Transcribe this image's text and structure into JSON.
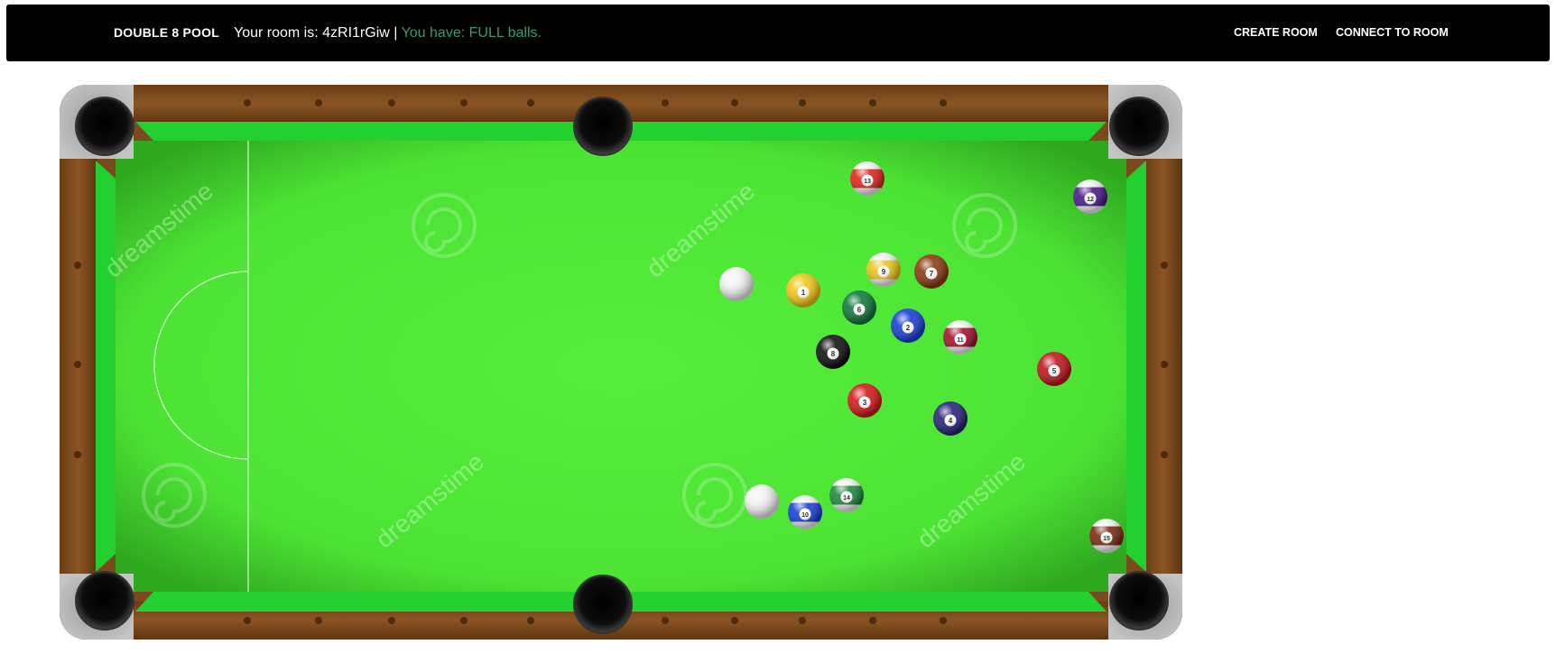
{
  "header": {
    "brand": "DOUBLE 8 POOL",
    "room_prefix": "Your room is: ",
    "room_code": "4zRI1rGiw",
    "separator": " | ",
    "balls_status": "You have: FULL balls."
  },
  "nav": {
    "create_room": "CREATE ROOM",
    "connect_room": "CONNECT TO ROOM"
  },
  "table": {
    "felt_color": "#4fe637",
    "rail_color": "#7a4a1e",
    "watermark": "dreamstime"
  },
  "balls": [
    {
      "label": "",
      "kind": "cue",
      "color": "#f2f2f2"
    },
    {
      "label": "",
      "kind": "cue",
      "color": "#f2f2f2"
    },
    {
      "label": "1",
      "kind": "solid",
      "color": "#f2c81a"
    },
    {
      "label": "2",
      "kind": "solid",
      "color": "#1a3fd6"
    },
    {
      "label": "3",
      "kind": "solid",
      "color": "#d41a1a"
    },
    {
      "label": "4",
      "kind": "solid",
      "color": "#27237a"
    },
    {
      "label": "5",
      "kind": "solid",
      "color": "#c0161e"
    },
    {
      "label": "6",
      "kind": "solid",
      "color": "#0f7a3a"
    },
    {
      "label": "7",
      "kind": "solid",
      "color": "#8b3a12"
    },
    {
      "label": "8",
      "kind": "solid",
      "color": "#111111"
    },
    {
      "label": "9",
      "kind": "stripe",
      "color": "#e8c81c"
    },
    {
      "label": "10",
      "kind": "stripe",
      "color": "#1a3fd6"
    },
    {
      "label": "11",
      "kind": "stripe",
      "color": "#a3122a"
    },
    {
      "label": "12",
      "kind": "stripe",
      "color": "#4b1a8a"
    },
    {
      "label": "13",
      "kind": "stripe",
      "color": "#e0261e"
    },
    {
      "label": "14",
      "kind": "stripe",
      "color": "#1f8a3e"
    },
    {
      "label": "15",
      "kind": "stripe",
      "color": "#7a2a12"
    }
  ]
}
